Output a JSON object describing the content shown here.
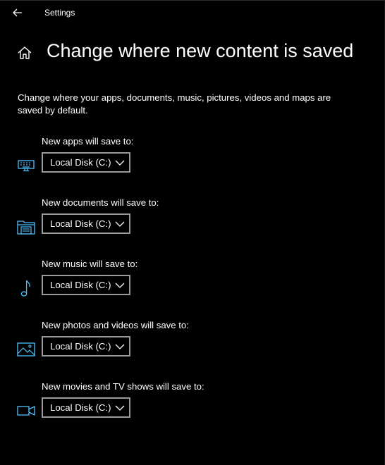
{
  "window": {
    "title": "Settings"
  },
  "page": {
    "title": "Change where new content is saved",
    "description": "Change where your apps, documents, music, pictures, videos and maps are saved by default."
  },
  "settings": [
    {
      "label": "New apps will save to:",
      "value": "Local Disk (C:)",
      "icon": "monitor-keyboard-icon"
    },
    {
      "label": "New documents will save to:",
      "value": "Local Disk (C:)",
      "icon": "folder-documents-icon"
    },
    {
      "label": "New music will save to:",
      "value": "Local Disk (C:)",
      "icon": "music-note-icon"
    },
    {
      "label": "New photos and videos will save to:",
      "value": "Local Disk (C:)",
      "icon": "picture-icon"
    },
    {
      "label": "New movies and TV shows will save to:",
      "value": "Local Disk (C:)",
      "icon": "video-camera-icon"
    }
  ],
  "colors": {
    "background": "#000000",
    "text": "#ffffff",
    "accent": "#4cc2ff",
    "dropdown_border": "#9a9a9a"
  }
}
